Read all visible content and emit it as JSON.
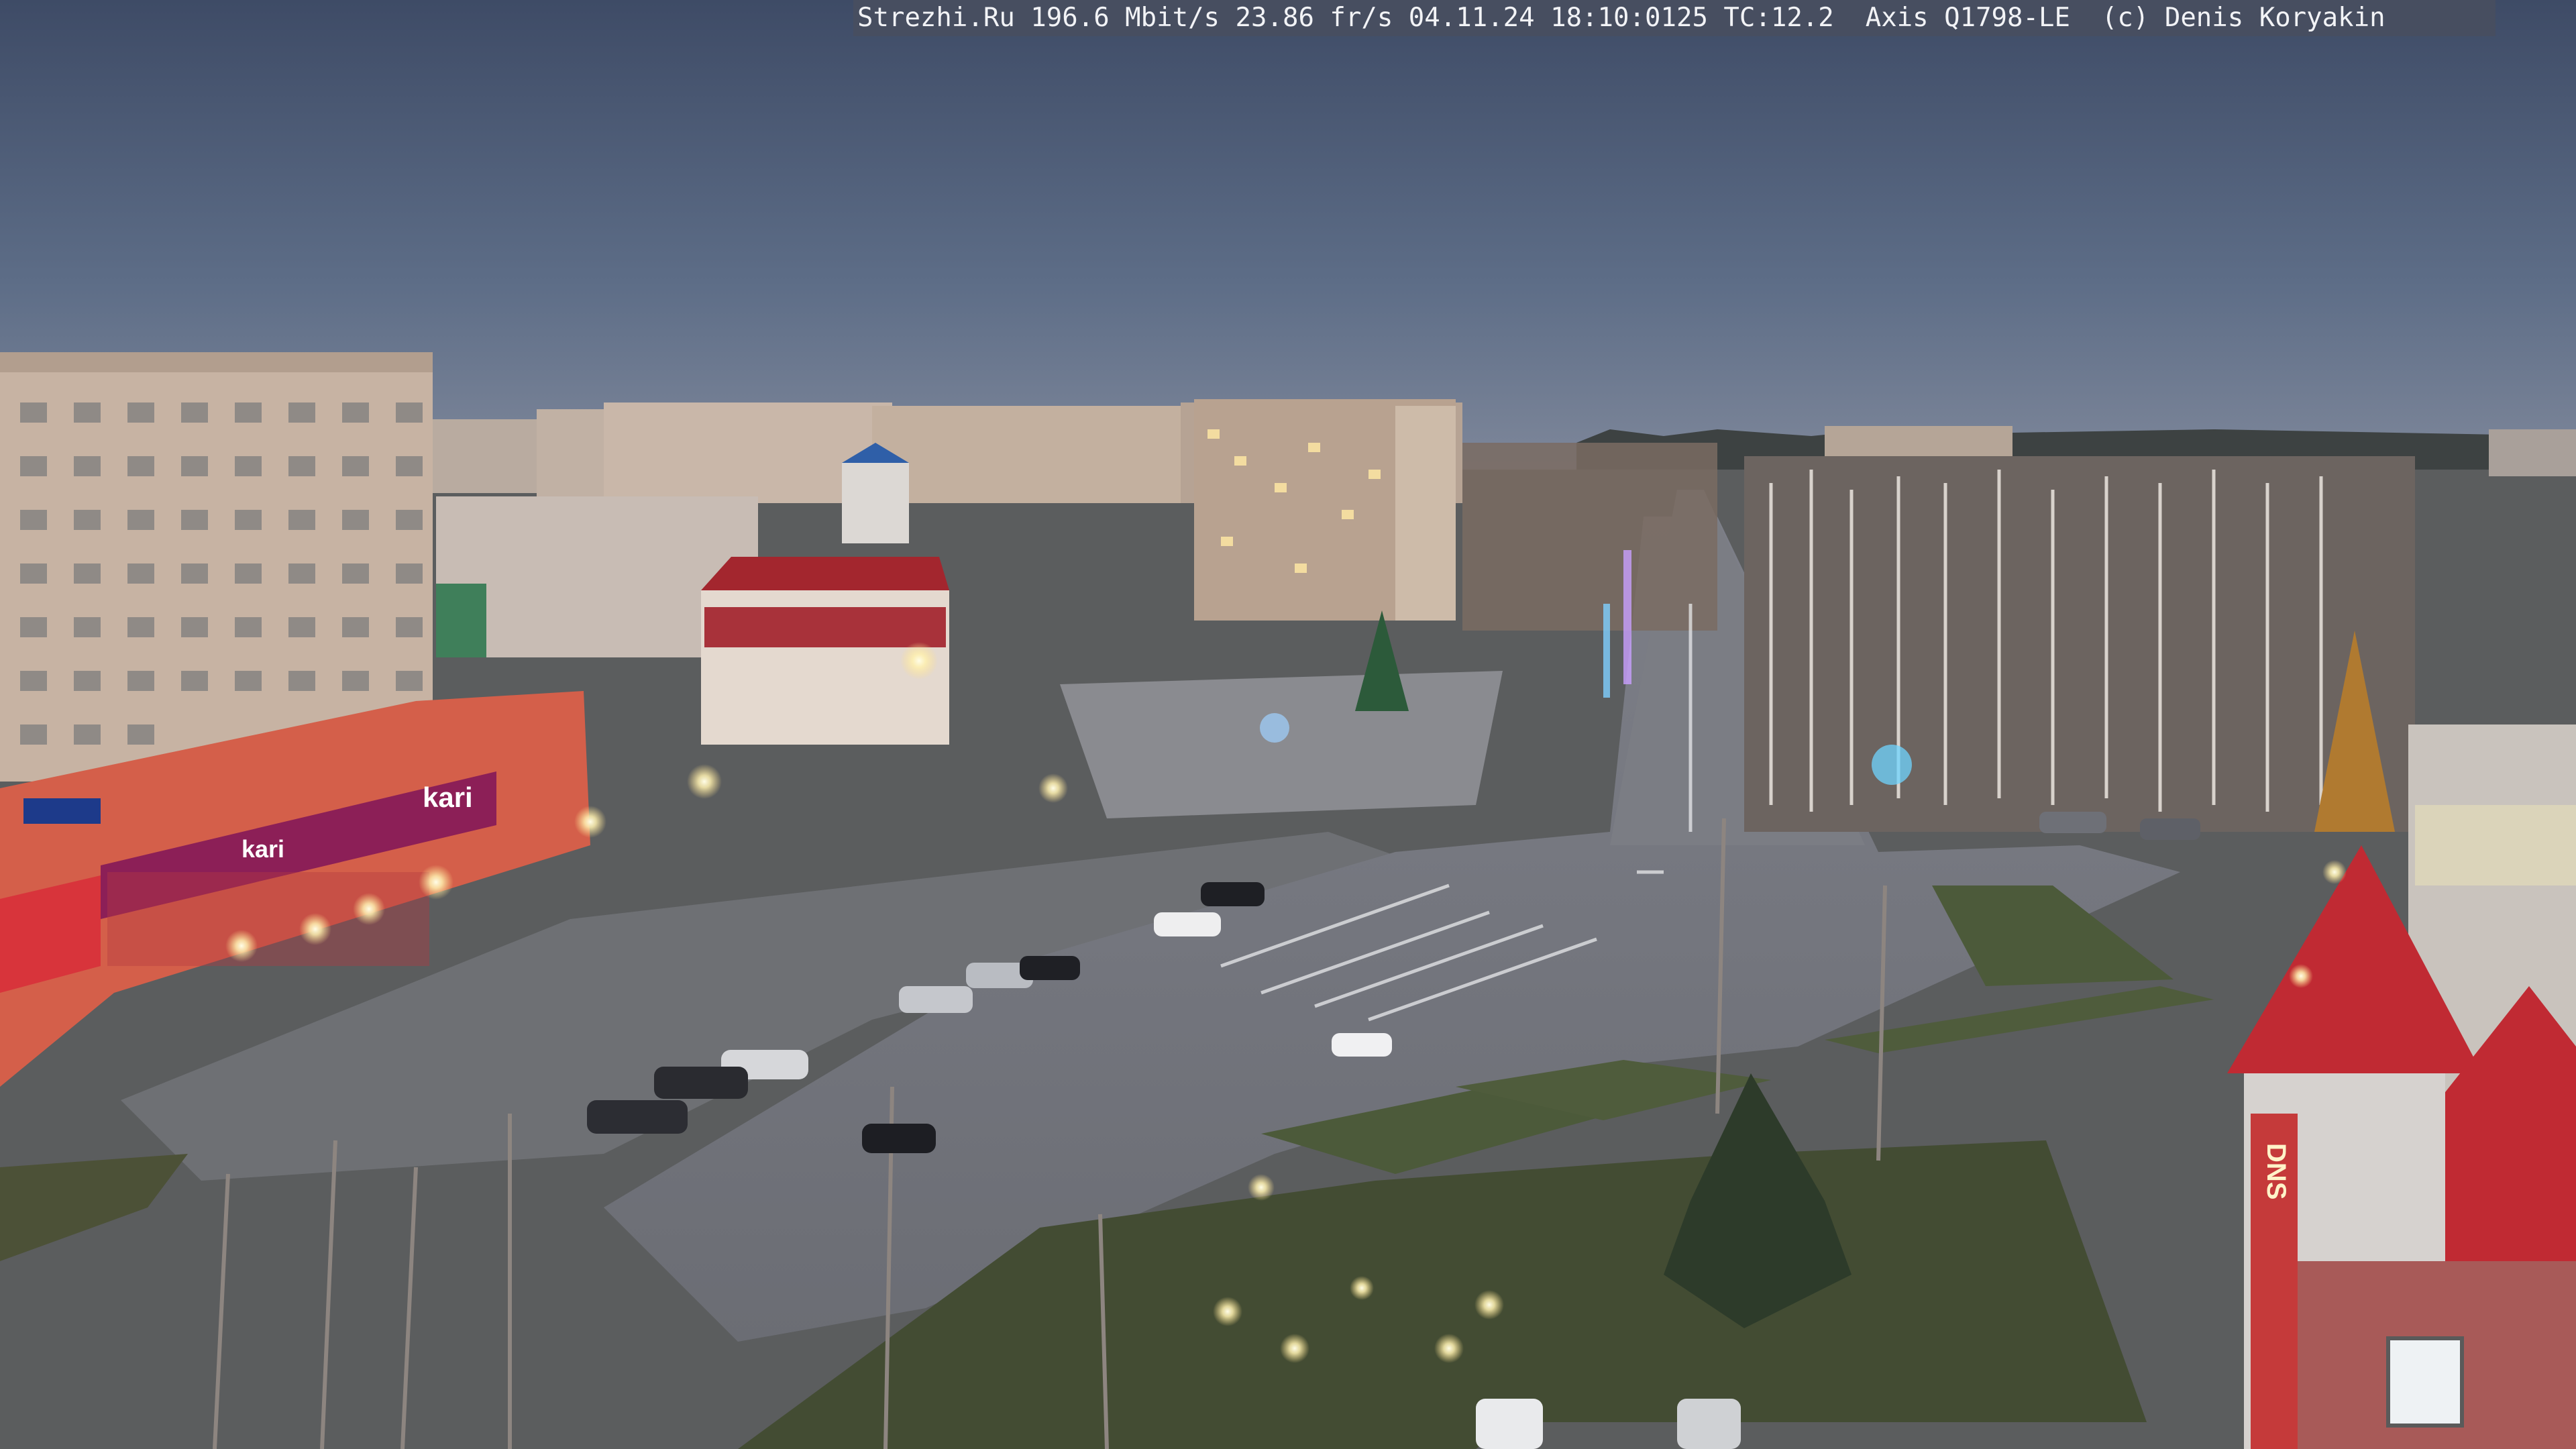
{
  "osd": {
    "text": "Strezhi.Ru 196.6 Mbit/s 23.86 fr/s 04.11.24 18:10:0125 TC:12.2  Axis Q1798-LE  (c) Denis Koryakin"
  },
  "signs": {
    "left_store_1": "kari",
    "left_store_2": "kari",
    "right_building_vertical": "DNS"
  }
}
